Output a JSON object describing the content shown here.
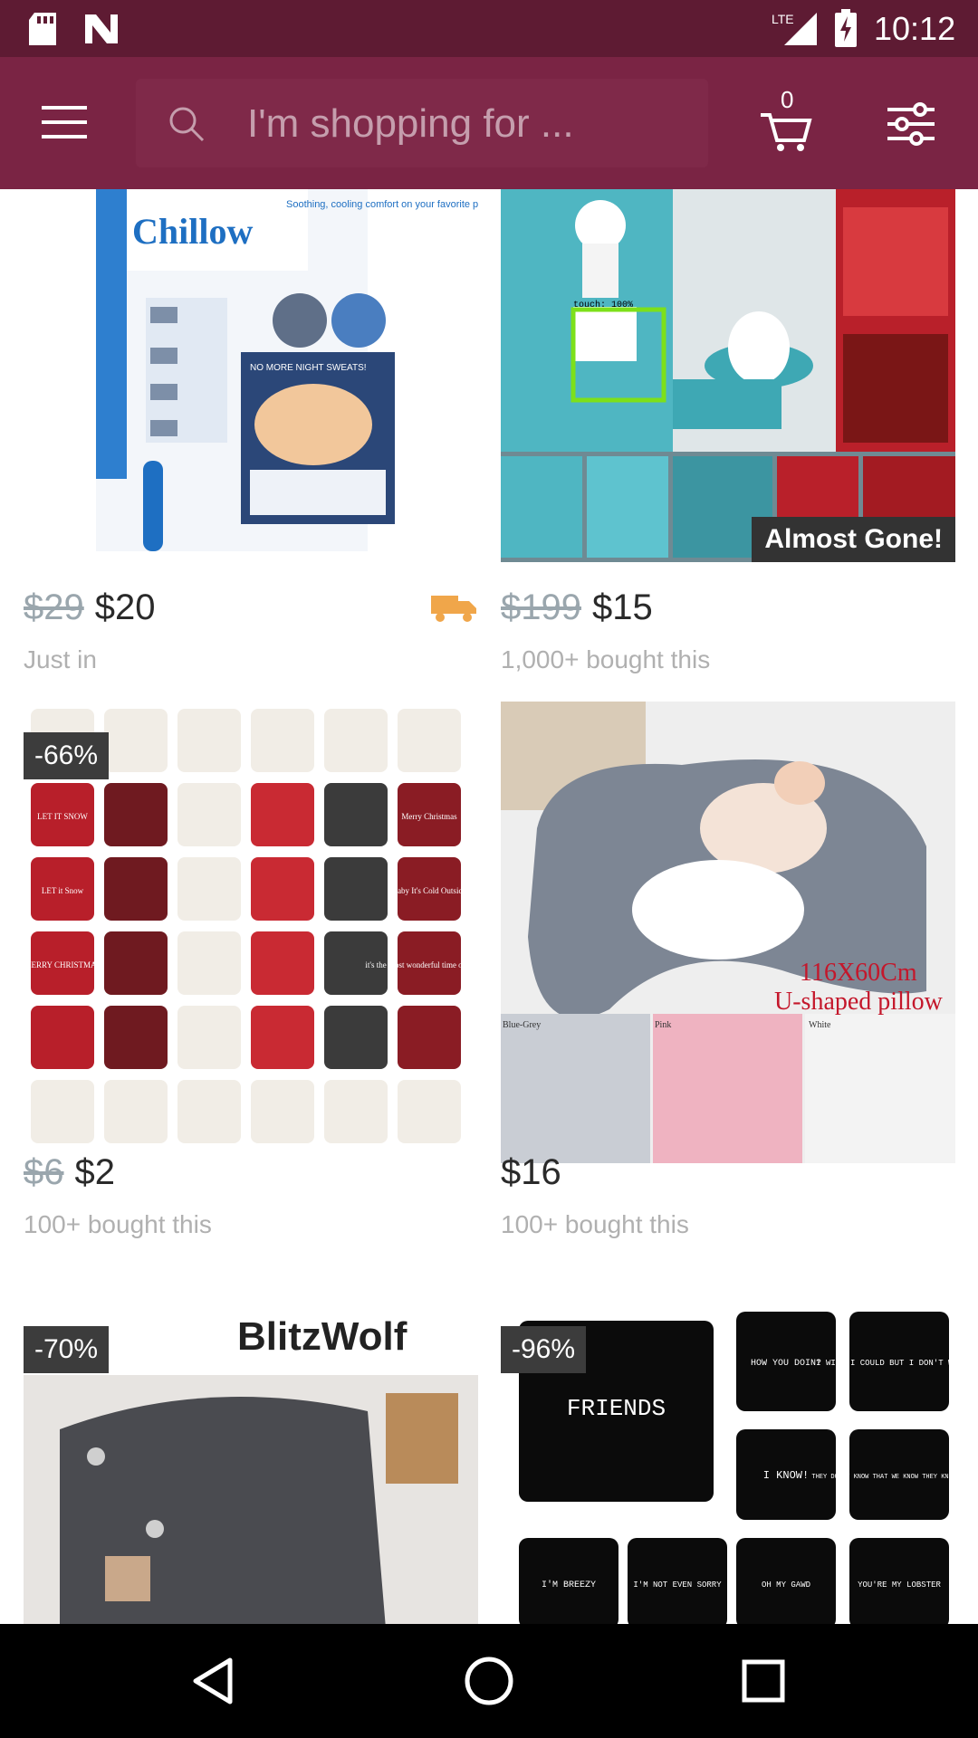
{
  "status": {
    "time": "10:12",
    "network": "LTE"
  },
  "search": {
    "placeholder": "I'm shopping for ..."
  },
  "cart": {
    "count": "0"
  },
  "colors": {
    "status_bar": "#5e1b33",
    "toolbar": "#7a2444",
    "badge": "#3c3c3c",
    "shipping": "#f0a64a"
  },
  "products": [
    {
      "old_price": "$29",
      "price": "$20",
      "subtitle": "Just in",
      "badge": "",
      "shipping_icon": "truck-icon"
    },
    {
      "old_price": "$199",
      "price": "$15",
      "subtitle": "1,000+ bought this",
      "badge": "",
      "tag": "Almost Gone!",
      "overlay_text": "touch: 100%"
    },
    {
      "old_price": "$6",
      "price": "$2",
      "subtitle": "100+ bought this",
      "badge": "-66%"
    },
    {
      "old_price": "",
      "price": "$16",
      "subtitle": "100+ bought this",
      "badge": "",
      "image_text": [
        "116X60Cm",
        "U-shaped pillow",
        "Blue-Grey",
        "Pink",
        "White"
      ]
    },
    {
      "badge": "-70%",
      "brand": "BlitzWolf"
    },
    {
      "badge": "-96%",
      "pillow_texts": [
        "FRIENDS",
        "HOW YOU DOIN?",
        "I WISH I COULD BUT I DON'T WANT TO",
        "I KNOW!",
        "THEY DON'T KNOW THAT WE KNOW THEY KNOW WE KNOW",
        "I'M BREEZY",
        "I'M NOT EVEN SORRY",
        "OH MY GAWD",
        "YOU'RE MY LOBSTER"
      ]
    }
  ],
  "product1_image": {
    "brand": "Chillow",
    "tagline": "Soothing, cooling comfort on your favorite pillow",
    "note": "NO MORE NIGHT SWEATS!"
  },
  "product3_image": {
    "labels": [
      "LET IT SNOW",
      "Merry Christmas",
      "LET it Snow",
      "Baby It's Cold Outside",
      "MERRY CHRISTMAS",
      "it's the most wonderful time of the year"
    ]
  },
  "navbar": {
    "back": "back-icon",
    "home": "home-icon",
    "recents": "recents-icon"
  }
}
